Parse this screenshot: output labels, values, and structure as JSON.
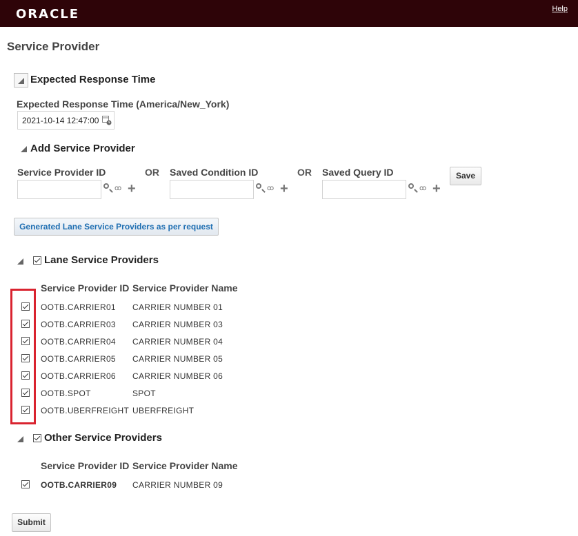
{
  "header": {
    "logo": "ORACLE",
    "help_label": "Help"
  },
  "page_title": "Service Provider",
  "expected_response": {
    "section_title": "Expected Response Time",
    "field_label": "Expected Response Time (America/New_York)",
    "value": "2021-10-14 12:47:00"
  },
  "add_provider": {
    "section_title": "Add Service Provider",
    "sp_id_label": "Service Provider ID",
    "or1": "OR",
    "saved_condition_label": "Saved Condition ID",
    "or2": "OR",
    "saved_query_label": "Saved Query ID",
    "save_label": "Save"
  },
  "generate_button_label": "Generated Lane Service Providers as per request",
  "lane_providers": {
    "section_title": "Lane Service Providers",
    "checked": true,
    "columns": [
      "Service Provider ID",
      "Service Provider Name"
    ],
    "rows": [
      {
        "id": "OOTB.CARRIER01",
        "name": "CARRIER NUMBER 01",
        "checked": true
      },
      {
        "id": "OOTB.CARRIER03",
        "name": "CARRIER NUMBER 03",
        "checked": true
      },
      {
        "id": "OOTB.CARRIER04",
        "name": "CARRIER NUMBER 04",
        "checked": true
      },
      {
        "id": "OOTB.CARRIER05",
        "name": "CARRIER NUMBER 05",
        "checked": true
      },
      {
        "id": "OOTB.CARRIER06",
        "name": "CARRIER NUMBER 06",
        "checked": true
      },
      {
        "id": "OOTB.SPOT",
        "name": "SPOT",
        "checked": true
      },
      {
        "id": "OOTB.UBERFREIGHT",
        "name": "UBERFREIGHT",
        "checked": true
      }
    ]
  },
  "other_providers": {
    "section_title": "Other Service Providers",
    "checked": true,
    "columns": [
      "Service Provider ID",
      "Service Provider Name"
    ],
    "rows": [
      {
        "id": "OOTB.CARRIER09",
        "name": "CARRIER NUMBER 09",
        "checked": true
      }
    ]
  },
  "submit_label": "Submit",
  "colors": {
    "header_bg": "#2e0408",
    "highlight": "#d9232f",
    "link_blue": "#1f6fb2"
  }
}
